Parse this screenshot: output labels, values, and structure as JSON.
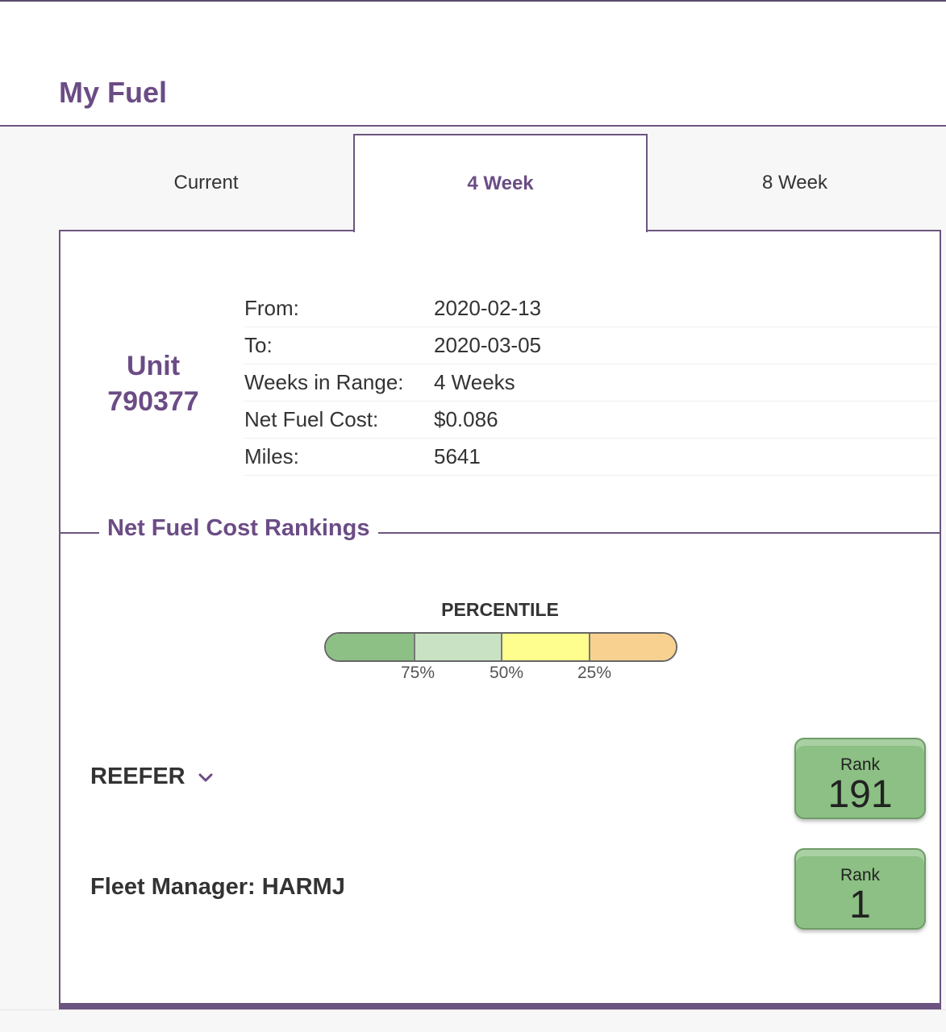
{
  "header": {
    "title": "My Fuel"
  },
  "tabs": [
    {
      "label": "Current",
      "active": false
    },
    {
      "label": "4 Week",
      "active": true
    },
    {
      "label": "8 Week",
      "active": false
    }
  ],
  "unit": {
    "label": "Unit",
    "number": "790377"
  },
  "info": [
    {
      "label": "From:",
      "value": "2020-02-13"
    },
    {
      "label": "To:",
      "value": "2020-03-05"
    },
    {
      "label": "Weeks in Range:",
      "value": "4 Weeks"
    },
    {
      "label": "Net Fuel Cost:",
      "value": "$0.086"
    },
    {
      "label": "Miles:",
      "value": "5641"
    }
  ],
  "rankings": {
    "title": "Net Fuel Cost Rankings",
    "percentile": {
      "label": "PERCENTILE",
      "ticks": [
        "75%",
        "50%",
        "25%"
      ],
      "segment_colors": [
        "#8cc084",
        "#c9e2c3",
        "#fdfe8d",
        "#f8d190"
      ]
    },
    "rows": [
      {
        "label": "REEFER",
        "rank_word": "Rank",
        "rank": "191",
        "has_dropdown": true
      },
      {
        "label": "Fleet Manager: HARMJ",
        "rank_word": "Rank",
        "rank": "1",
        "has_dropdown": false
      }
    ],
    "badge_color": "#8cc084"
  }
}
